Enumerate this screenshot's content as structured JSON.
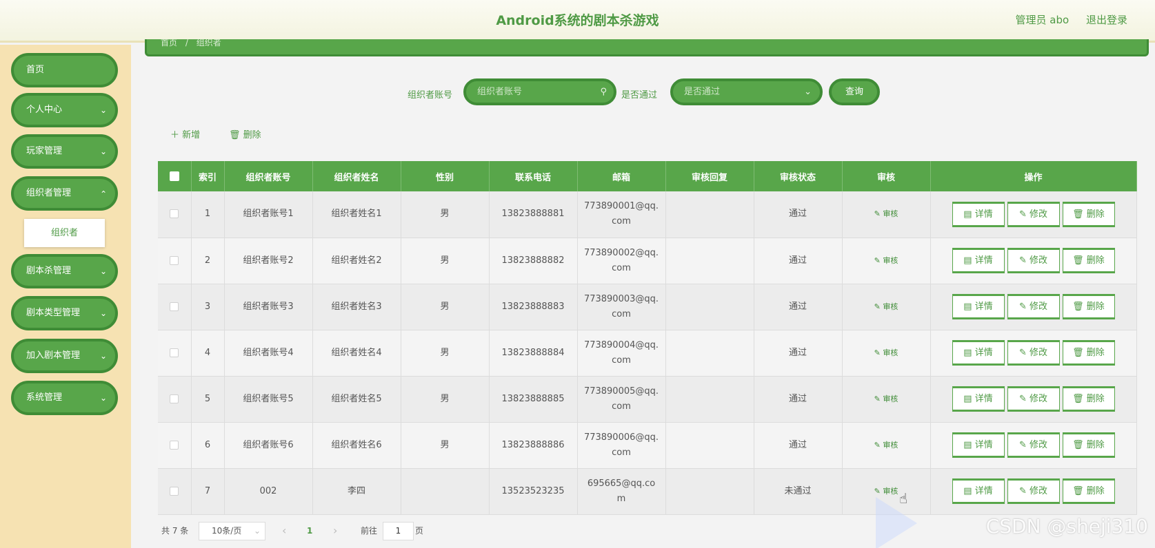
{
  "header": {
    "title": "Android系统的剧本杀游戏",
    "user": "管理员 abo",
    "logout": "退出登录"
  },
  "sidebar": {
    "items": [
      {
        "label": "首页"
      },
      {
        "label": "个人中心"
      },
      {
        "label": "玩家管理"
      },
      {
        "label": "组织者管理"
      },
      {
        "label": "剧本杀管理"
      },
      {
        "label": "剧本类型管理"
      },
      {
        "label": "加入剧本管理"
      },
      {
        "label": "系统管理"
      }
    ],
    "submenu": "组织者",
    "chevron": "⌄"
  },
  "breadcrumb": {
    "home": "首页",
    "sep": "/",
    "current": "组织者"
  },
  "search": {
    "account_label": "组织者账号",
    "account_placeholder": "组织者账号",
    "pass_label": "是否通过",
    "pass_placeholder": "是否通过",
    "query": "查询"
  },
  "toolbar": {
    "add": "＋ 新增",
    "delete": "🗑 删除"
  },
  "table": {
    "headers": [
      "索引",
      "组织者账号",
      "组织者姓名",
      "性别",
      "联系电话",
      "邮箱",
      "审核回复",
      "审核状态",
      "审核",
      "操作"
    ],
    "audit_label": "✎ 审核",
    "ops": [
      "▤ 详情",
      "✎ 修改",
      "🗑 删除"
    ],
    "rows": [
      {
        "idx": "1",
        "account": "组织者账号1",
        "name": "组织者姓名1",
        "gender": "男",
        "phone": "13823888881",
        "email_a": "773890001@qq.",
        "email_b": "com",
        "reply": "",
        "status": "通过"
      },
      {
        "idx": "2",
        "account": "组织者账号2",
        "name": "组织者姓名2",
        "gender": "男",
        "phone": "13823888882",
        "email_a": "773890002@qq.",
        "email_b": "com",
        "reply": "",
        "status": "通过"
      },
      {
        "idx": "3",
        "account": "组织者账号3",
        "name": "组织者姓名3",
        "gender": "男",
        "phone": "13823888883",
        "email_a": "773890003@qq.",
        "email_b": "com",
        "reply": "",
        "status": "通过"
      },
      {
        "idx": "4",
        "account": "组织者账号4",
        "name": "组织者姓名4",
        "gender": "男",
        "phone": "13823888884",
        "email_a": "773890004@qq.",
        "email_b": "com",
        "reply": "",
        "status": "通过"
      },
      {
        "idx": "5",
        "account": "组织者账号5",
        "name": "组织者姓名5",
        "gender": "男",
        "phone": "13823888885",
        "email_a": "773890005@qq.",
        "email_b": "com",
        "reply": "",
        "status": "通过"
      },
      {
        "idx": "6",
        "account": "组织者账号6",
        "name": "组织者姓名6",
        "gender": "男",
        "phone": "13823888886",
        "email_a": "773890006@qq.",
        "email_b": "com",
        "reply": "",
        "status": "通过"
      },
      {
        "idx": "7",
        "account": "002",
        "name": "李四",
        "gender": "",
        "phone": "13523523235",
        "email_a": "695665@qq.co",
        "email_b": "m",
        "reply": "",
        "status": "未通过"
      }
    ]
  },
  "pagination": {
    "total": "共 7 条",
    "page_size": "10条/页",
    "prev": "‹",
    "current": "1",
    "next": "›",
    "goto_label": "前往",
    "goto_value": "1",
    "page_suffix": "页"
  },
  "watermark": "CSDN @sheji310"
}
